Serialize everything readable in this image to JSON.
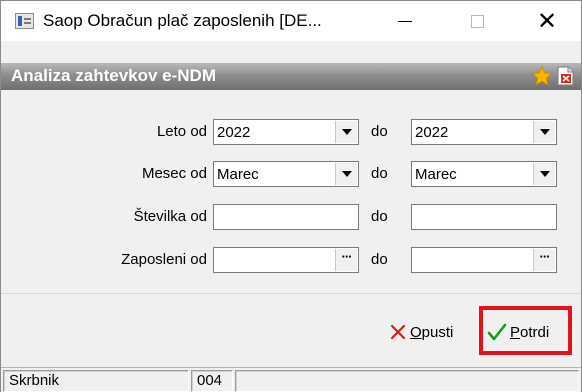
{
  "window": {
    "title": "Saop Obračun plač zaposlenih [DE...",
    "controls": {
      "minimize": "minimize",
      "maximize": "maximize",
      "close": "✕"
    }
  },
  "header": {
    "title": "Analiza zahtevkov e-NDM",
    "favorite_icon": "star-icon",
    "report_icon": "pdf-close-icon"
  },
  "form": {
    "leto": {
      "label": "Leto od",
      "from": "2022",
      "to_label": "do",
      "to": "2022"
    },
    "mesec": {
      "label": "Mesec od",
      "from": "Marec",
      "to_label": "do",
      "to": "Marec"
    },
    "stevilka": {
      "label": "Številka od",
      "from": "",
      "to_label": "do",
      "to": ""
    },
    "zaposleni": {
      "label": "Zaposleni od",
      "from": "",
      "to_label": "do",
      "to": "",
      "lookup_glyph": "···"
    }
  },
  "buttons": {
    "cancel": {
      "first": "O",
      "rest": "pusti",
      "icon": "red-x-icon"
    },
    "confirm": {
      "first": "P",
      "rest": "otrdi",
      "icon": "green-check-icon"
    }
  },
  "statusbar": {
    "user": "Skrbnik",
    "code": "004",
    "info": ""
  },
  "colors": {
    "highlight": "#e3131b",
    "header_band": "#8e8e8e",
    "confirm_check": "#1a9a1a",
    "cancel_x": "#d31e1e"
  }
}
